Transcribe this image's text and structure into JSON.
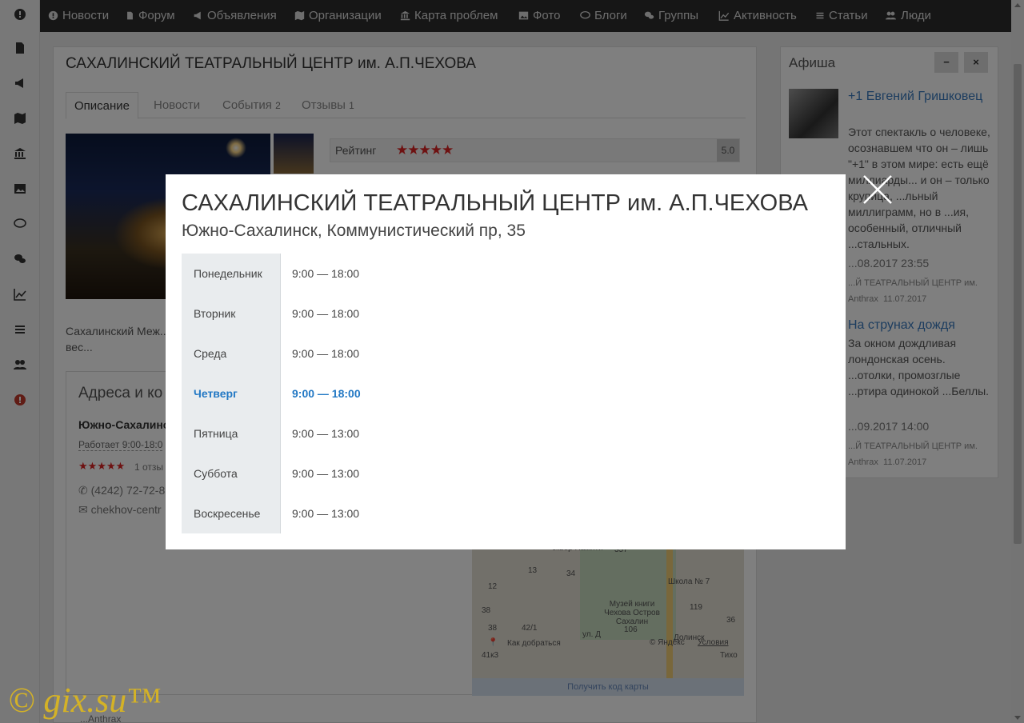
{
  "nav": {
    "items": [
      {
        "icon": "info-circle-icon",
        "label": "Новости"
      },
      {
        "icon": "file-icon",
        "label": "Форум"
      },
      {
        "icon": "bullhorn-icon",
        "label": "Объявления"
      },
      {
        "icon": "map-icon",
        "label": "Организации"
      },
      {
        "icon": "bank-icon",
        "label": "Карта проблем"
      },
      {
        "icon": "picture-icon",
        "label": "Фото"
      },
      {
        "icon": "comment-icon",
        "label": "Блоги"
      },
      {
        "icon": "comments-icon",
        "label": "Группы"
      },
      {
        "icon": "chart-line-icon",
        "label": "Активность"
      },
      {
        "icon": "list-icon",
        "label": "Статьи"
      },
      {
        "icon": "users-icon",
        "label": "Люди"
      }
    ]
  },
  "page": {
    "title": "САХАЛИНСКИЙ ТЕАТРАЛЬНЫЙ ЦЕНТР им. А.П.ЧЕХОВА",
    "tabs": [
      {
        "label": "Описание",
        "count": ""
      },
      {
        "label": "Новости",
        "count": ""
      },
      {
        "label": "События",
        "count": "2"
      },
      {
        "label": "Отзывы",
        "count": "1"
      }
    ],
    "rating": {
      "label": "Рейтинг",
      "stars": "★★★★★",
      "value": "5.0"
    },
    "description": "Сахалинский Меж... области, начал вес...",
    "address": {
      "heading": "Адреса и ко",
      "city": "Южно-Сахалинс",
      "hours": "Работает 9:00-18:0",
      "stars": "★★★★★",
      "reviews": "1 отзы",
      "phone": "(4242) 72-72-8",
      "email": "chekhov-centr"
    },
    "map": {
      "labels": [
        "сквер Памяти",
        "357",
        "13",
        "34",
        "12",
        "Школа № 7",
        "Музей книги Чехова Остров Сахалин",
        "38",
        "38",
        "42/1",
        "106",
        "119",
        "36",
        "ул. Д",
        "Долинск",
        "Тихо",
        "41к3"
      ],
      "route": "Как добраться",
      "copyright": "© Яндекс",
      "terms": "Условия",
      "footer": "Получить код карты"
    }
  },
  "afisha": {
    "title": "Афиша",
    "minimize": "−",
    "close": "×",
    "events": [
      {
        "title": "+1 Евгений Гришковец",
        "text": "Этот спектакль о человеке, осознавшем что он – лишь \"+1\" в этом мире: есть ещё миллиарды... и он – только крупица, ...льный миллиграмм, но в ...ия, особенный, отличный ...стальных.",
        "date": "...08.2017 23:55",
        "venue": "...Й ТЕАТРАЛЬНЫЙ ЦЕНТР им.",
        "author": "Anthrax",
        "posted": "11.07.2017"
      },
      {
        "title": "На струнах дождя",
        "text": "За окном дождливая лондонская осень. ...отолки, промозглые ...ртира одинокой ...Беллы.",
        "date": "...09.2017 14:00",
        "venue": "...Й ТЕАТРАЛЬНЫЙ ЦЕНТР им.",
        "author": "Anthrax",
        "posted": "11.07.2017"
      }
    ]
  },
  "modal": {
    "title": "САХАЛИНСКИЙ ТЕАТРАЛЬНЫЙ ЦЕНТР им. А.П.ЧЕХОВА",
    "subtitle": "Южно-Сахалинск, Коммунистический пр, 35",
    "schedule": [
      {
        "day": "Понедельник",
        "time": "9:00 — 18:00"
      },
      {
        "day": "Вторник",
        "time": "9:00 — 18:00"
      },
      {
        "day": "Среда",
        "time": "9:00 — 18:00"
      },
      {
        "day": "Четверг",
        "time": "9:00 — 18:00",
        "today": true
      },
      {
        "day": "Пятница",
        "time": "9:00 — 13:00"
      },
      {
        "day": "Суббота",
        "time": "9:00 — 13:00"
      },
      {
        "day": "Воскресенье",
        "time": "9:00 — 13:00"
      }
    ]
  },
  "watermark": "© gix.su™",
  "footer": "...Anthrax"
}
